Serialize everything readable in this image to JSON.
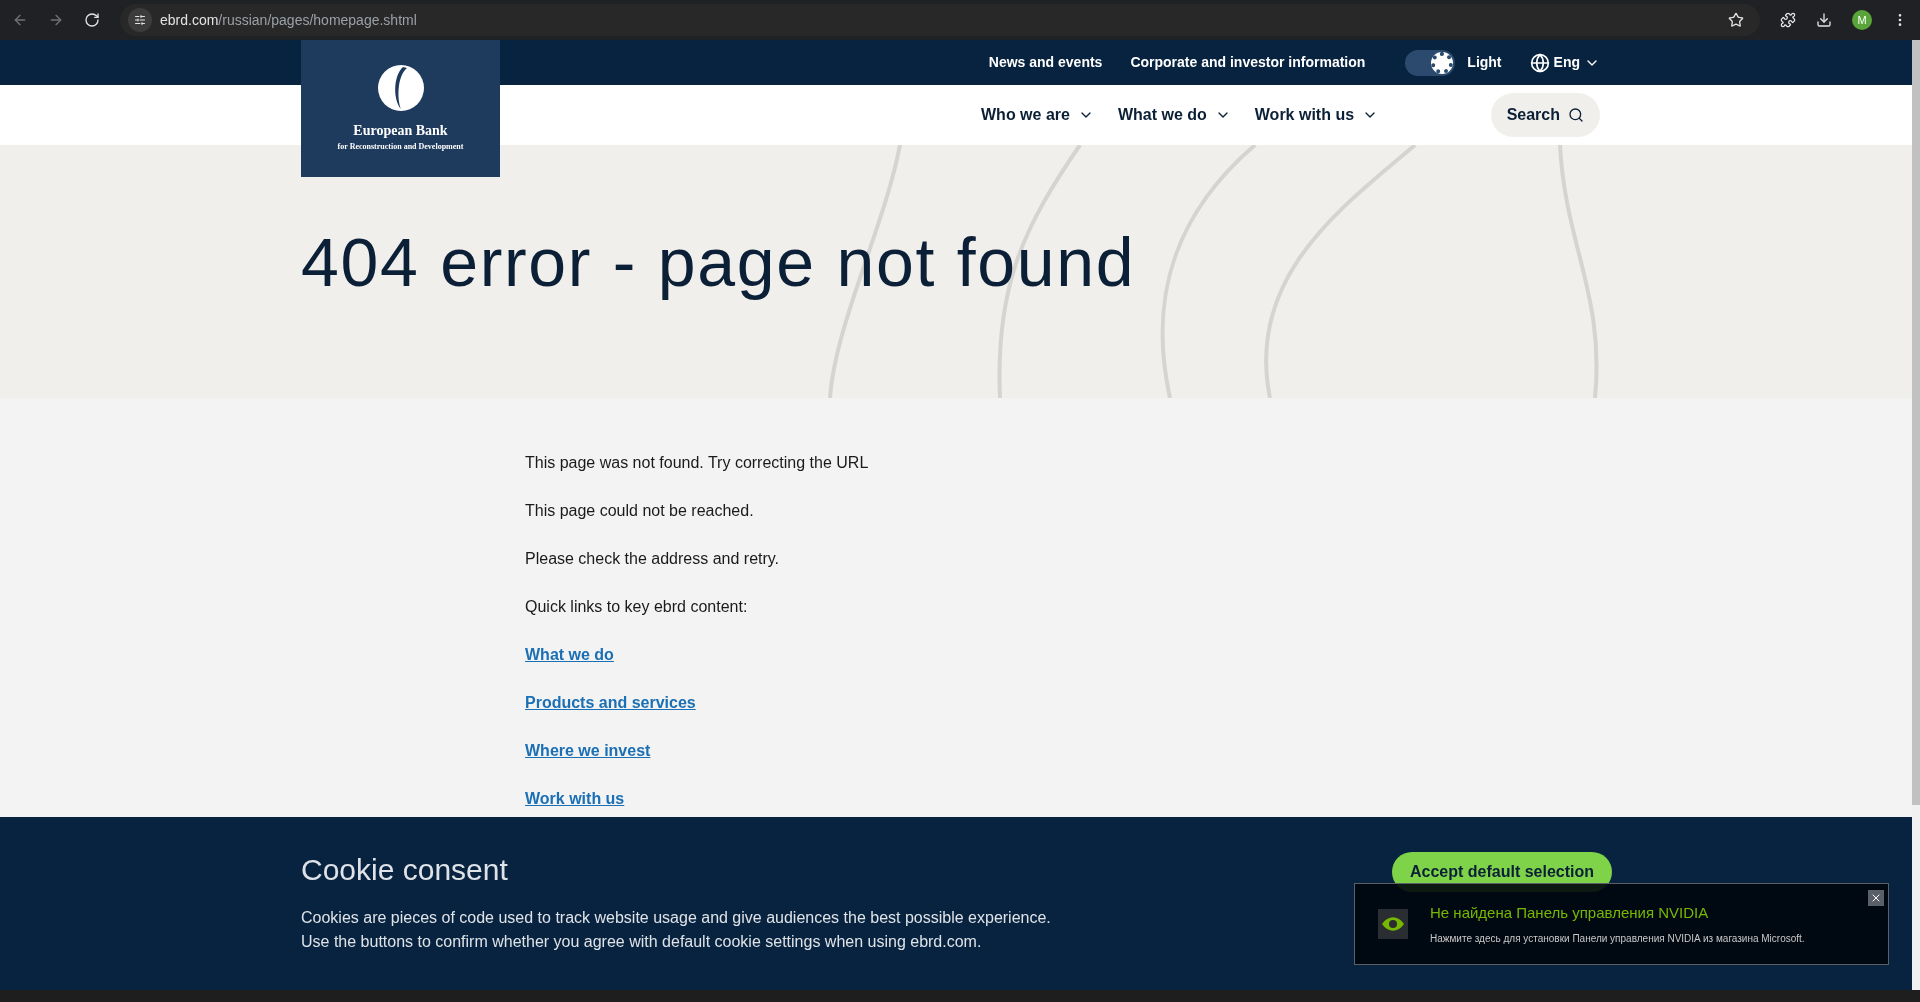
{
  "browser": {
    "url_host": "ebrd.com",
    "url_path": "/russian/pages/homepage.shtml",
    "profile_initial": "M"
  },
  "logo": {
    "title": "European Bank",
    "subtitle": "for Reconstruction and Development"
  },
  "top_nav": {
    "links": [
      "News and events",
      "Corporate and investor information"
    ],
    "theme_toggle": {
      "label": "Light",
      "on": true
    },
    "language": "Eng"
  },
  "main_nav": {
    "items": [
      "Who we are",
      "What we do",
      "Work with us"
    ],
    "search": "Search"
  },
  "hero": {
    "title": "404 error - page not found"
  },
  "content": {
    "paragraphs": [
      "This page was not found. Try correcting the URL",
      "This page could not be reached.",
      "Please check the address and retry.",
      "Quick links to key ebrd content:"
    ],
    "links": [
      "What we do",
      "Products and services",
      "Where we invest",
      "Work with us"
    ]
  },
  "cookie_banner": {
    "title": "Cookie consent",
    "lines": [
      "Cookies are pieces of code used to track website usage and give audiences the best possible experience.",
      "Use the buttons to confirm whether you agree with default cookie settings when using ebrd.com."
    ],
    "accept": "Accept default selection"
  },
  "notification": {
    "title": "Не найдена Панель управления NVIDIA",
    "message": "Нажмите здесь для установки Панели управления NVIDIA из магазина Microsoft."
  }
}
